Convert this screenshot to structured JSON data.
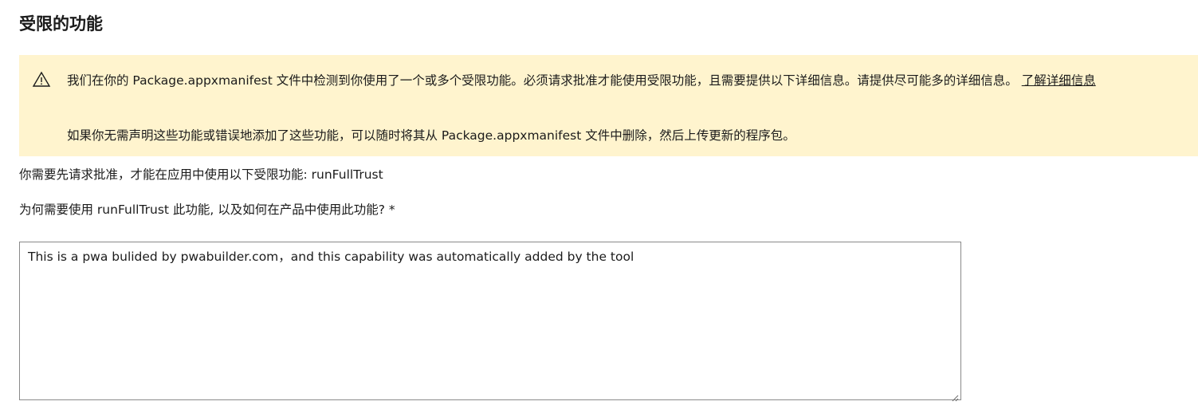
{
  "section": {
    "title": "受限的功能"
  },
  "warning": {
    "icon": "warning-triangle-icon",
    "message": "我们在你的 Package.appxmanifest 文件中检测到你使用了一个或多个受限功能。必须请求批准才能使用受限功能，且需要提供以下详细信息。请提供尽可能多的详细信息。",
    "learn_more_label": "了解详细信息",
    "secondary_message": "如果你无需声明这些功能或错误地添加了这些功能，可以随时将其从 Package.appxmanifest 文件中删除，然后上传更新的程序包。"
  },
  "approval": {
    "text": "你需要先请求批准，才能在应用中使用以下受限功能: runFullTrust"
  },
  "question": {
    "label": "为何需要使用 runFullTrust 此功能, 以及如何在产品中使用此功能? *"
  },
  "answer": {
    "value": "This is a pwa bulided by pwabuilder.com，and this capability was automatically added by the tool"
  },
  "colors": {
    "warning_background": "#fff4ce",
    "text": "#1b1b1b",
    "input_border": "#8a8a8a"
  }
}
